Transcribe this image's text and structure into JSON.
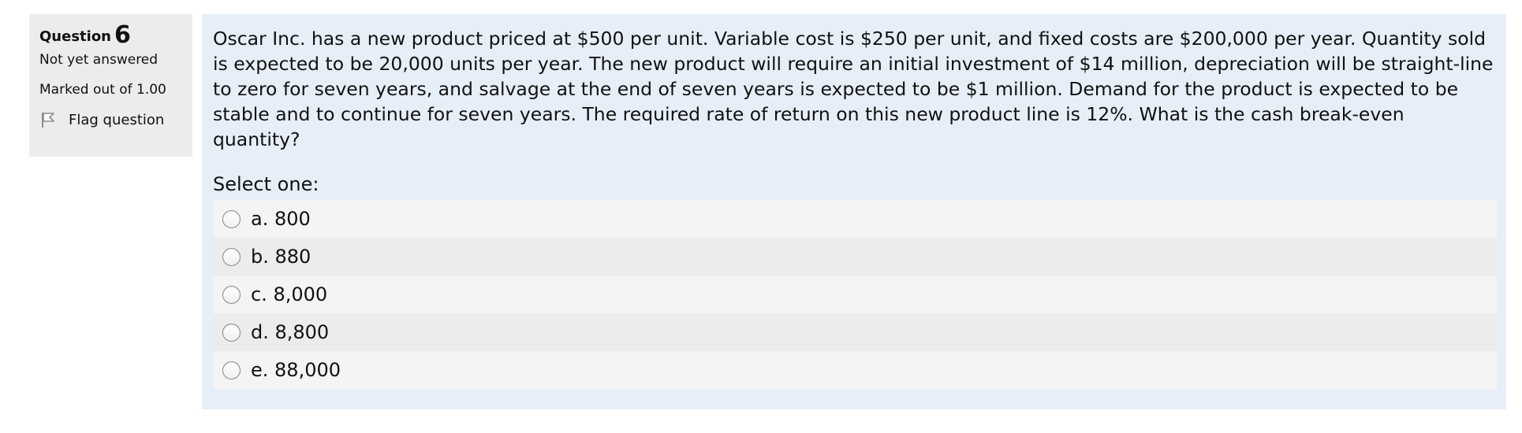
{
  "info": {
    "question_label": "Question",
    "question_number": "6",
    "state": "Not yet answered",
    "mark": "Marked out of 1.00",
    "flag_label": "Flag question"
  },
  "question": {
    "text": "Oscar Inc. has a new product priced at $500 per unit. Variable cost is $250 per unit, and fixed costs are $200,000 per year. Quantity sold is expected to be 20,000 units per year. The new product will require an initial investment of $14 million, depreciation will be straight-line to zero for seven years, and salvage at the end of seven years is expected to be $1 million. Demand for the product is expected to be stable and to continue for seven years. The required rate of return on this new product line is 12%. What is the cash break-even quantity?",
    "prompt": "Select one:",
    "answers": [
      {
        "label": "a. 800"
      },
      {
        "label": "b. 880"
      },
      {
        "label": "c. 8,000"
      },
      {
        "label": "d. 8,800"
      },
      {
        "label": "e. 88,000"
      }
    ]
  },
  "icons": {
    "flag": "flag-icon",
    "radio": "radio-unchecked"
  },
  "colors": {
    "info_bg": "#ececec",
    "content_bg": "#e6eff8",
    "answer_bg_light": "#f4f4f4",
    "answer_bg_dark": "#ececec"
  }
}
